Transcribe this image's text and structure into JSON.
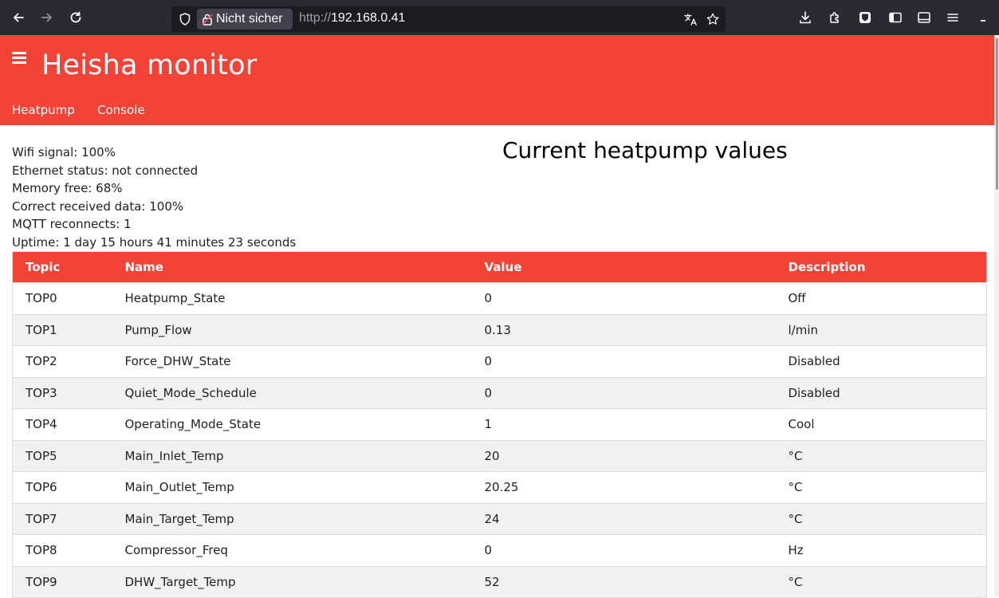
{
  "browser": {
    "security_label": "Nicht sicher",
    "url_protocol": "http://",
    "url_host": "192.168.0.41",
    "icons": [
      "back-icon",
      "forward-icon",
      "reload-icon",
      "shield-icon",
      "lock-warning-icon",
      "translate-icon",
      "bookmark-star-icon",
      "download-icon",
      "extensions-icon",
      "bitwarden-icon",
      "sidebar-icon",
      "reader-view-icon",
      "menu-icon",
      "minimize-icon"
    ]
  },
  "header": {
    "title": "Heisha monitor",
    "nav": [
      "Heatpump",
      "Console"
    ],
    "accent_color": "#f44336"
  },
  "status": {
    "wifi": "Wifi signal: 100%",
    "ethernet": "Ethernet status: not connected",
    "memory": "Memory free: 68%",
    "received": "Correct received data: 100%",
    "mqtt": "MQTT reconnects: 1",
    "uptime": "Uptime: 1 day 15 hours 41 minutes 23 seconds"
  },
  "main": {
    "title": "Current heatpump values",
    "table": {
      "headers": [
        "Topic",
        "Name",
        "Value",
        "Description"
      ],
      "rows": [
        [
          "TOP0",
          "Heatpump_State",
          "0",
          "Off"
        ],
        [
          "TOP1",
          "Pump_Flow",
          "0.13",
          "l/min"
        ],
        [
          "TOP2",
          "Force_DHW_State",
          "0",
          "Disabled"
        ],
        [
          "TOP3",
          "Quiet_Mode_Schedule",
          "0",
          "Disabled"
        ],
        [
          "TOP4",
          "Operating_Mode_State",
          "1",
          "Cool"
        ],
        [
          "TOP5",
          "Main_Inlet_Temp",
          "20",
          "°C"
        ],
        [
          "TOP6",
          "Main_Outlet_Temp",
          "20.25",
          "°C"
        ],
        [
          "TOP7",
          "Main_Target_Temp",
          "24",
          "°C"
        ],
        [
          "TOP8",
          "Compressor_Freq",
          "0",
          "Hz"
        ],
        [
          "TOP9",
          "DHW_Target_Temp",
          "52",
          "°C"
        ]
      ]
    }
  }
}
